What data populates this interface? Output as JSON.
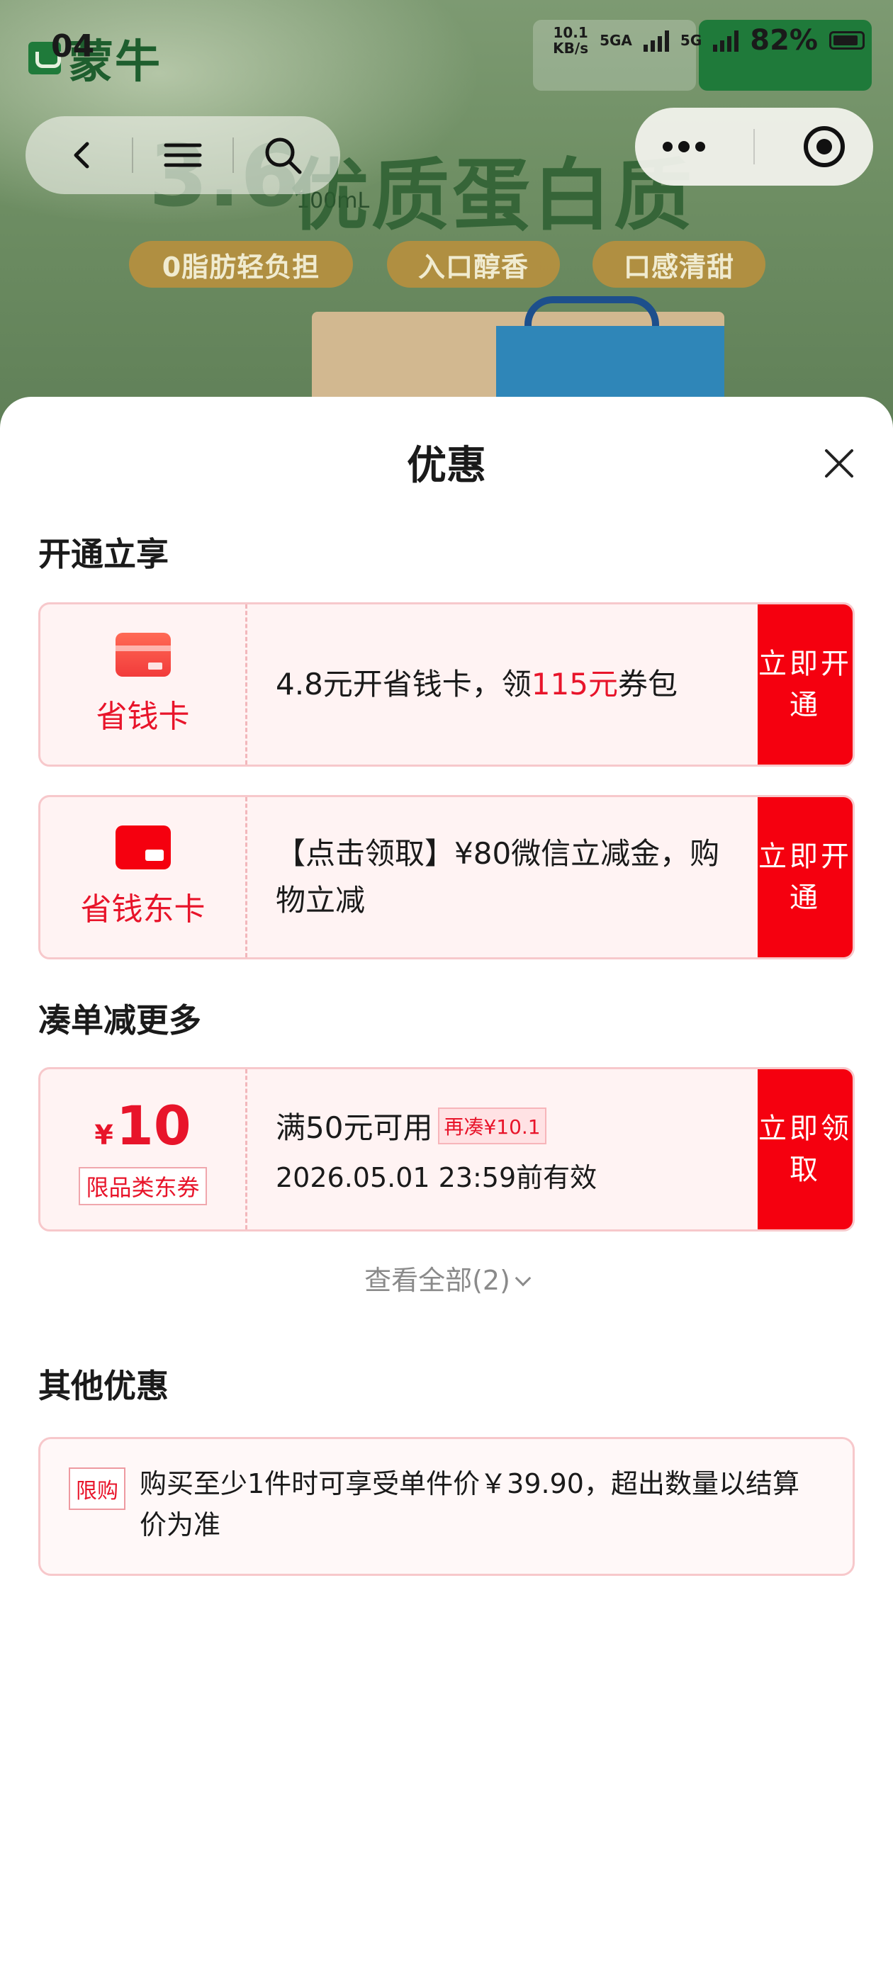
{
  "status_bar": {
    "time": "04",
    "net_speed_value": "10.1",
    "net_speed_unit": "KB/s",
    "network_tag_1": "5GA",
    "network_tag_2": "5G",
    "battery_percent": "82%"
  },
  "banner": {
    "brand": "蒙牛",
    "headline": "优质蛋白质",
    "headline_number": "3.6",
    "unit": "100mL",
    "pills": [
      "0脂肪轻负担",
      "入口醇香",
      "口感清甜"
    ]
  },
  "sheet": {
    "title": "优惠",
    "section_open": "开通立享",
    "cards": [
      {
        "name": "省钱卡",
        "text_prefix": "4.8元开省钱卡，领",
        "text_highlight": "115元",
        "text_suffix": "券包",
        "action": "立即开通"
      },
      {
        "name": "省钱东卡",
        "text": "【点击领取】¥80微信立减金，购物立减",
        "action": "立即开通"
      }
    ],
    "section_more": "凑单减更多",
    "coupon": {
      "currency": "¥",
      "amount": "10",
      "type": "限品类东券",
      "condition": "满50元可用",
      "tag": "再凑¥10.1",
      "expiry": "2026.05.01 23:59前有效",
      "action": "立即领取"
    },
    "view_all": "查看全部(2)",
    "section_other": "其他优惠",
    "other": {
      "tag": "限购",
      "text": "购买至少1件时可享受单件价￥39.90，超出数量以结算价为准"
    }
  },
  "colors": {
    "accent_red": "#f5000f",
    "text_red": "#e8142a",
    "card_bg": "#fff3f3",
    "card_border": "#f7c8cb"
  },
  "icons": [
    "back-icon",
    "menu-icon",
    "search-icon",
    "more-icon",
    "target-icon",
    "close-icon",
    "card-icon",
    "chevron-down-icon"
  ]
}
